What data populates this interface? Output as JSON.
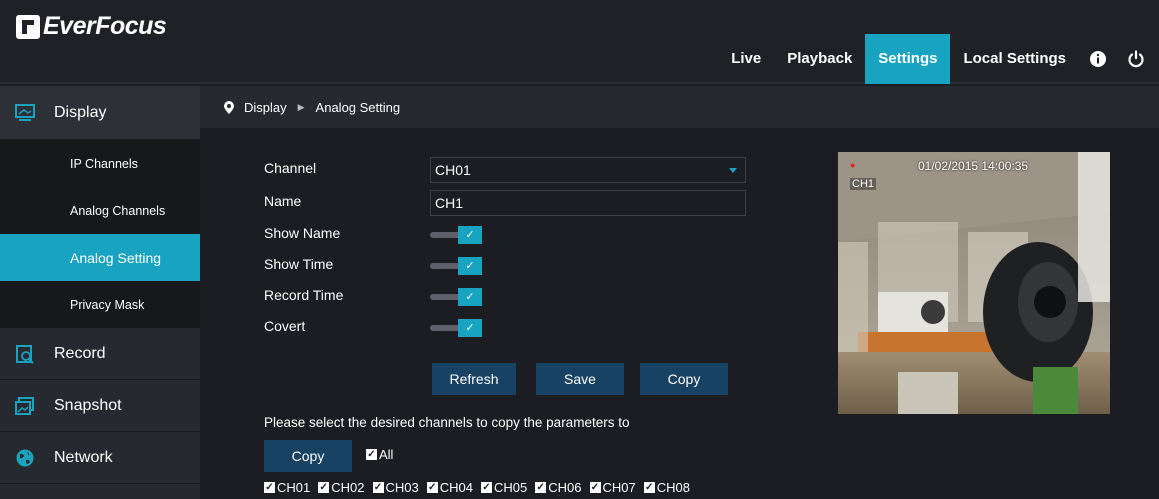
{
  "brand": {
    "name": "EverFocus"
  },
  "nav": {
    "items": [
      {
        "label": "Live",
        "active": false
      },
      {
        "label": "Playback",
        "active": false
      },
      {
        "label": "Settings",
        "active": true
      },
      {
        "label": "Local Settings",
        "active": false
      }
    ],
    "icons": [
      "info-icon",
      "power-icon"
    ]
  },
  "sidebar": {
    "display_label": "Display",
    "display_items": [
      {
        "label": "IP Channels"
      },
      {
        "label": "Analog Channels"
      },
      {
        "label": "Analog Setting"
      },
      {
        "label": "Privacy Mask"
      }
    ],
    "record_label": "Record",
    "snapshot_label": "Snapshot",
    "network_label": "Network"
  },
  "breadcrumb": {
    "root": "Display",
    "current": "Analog Setting"
  },
  "form": {
    "channel_label": "Channel",
    "channel_value": "CH01",
    "name_label": "Name",
    "name_value": "CH1",
    "show_name_label": "Show Name",
    "show_time_label": "Show Time",
    "record_time_label": "Record Time",
    "covert_label": "Covert",
    "toggles_checked": true
  },
  "buttons": {
    "refresh": "Refresh",
    "save": "Save",
    "copy": "Copy"
  },
  "preview": {
    "osd_time": "01/02/2015 14:00:35",
    "osd_name": "CH1"
  },
  "copy_section": {
    "message": "Please select the desired channels to copy the parameters to",
    "copy_button": "Copy",
    "all_label": "All",
    "channels": [
      "CH01",
      "CH02",
      "CH03",
      "CH04",
      "CH05",
      "CH06",
      "CH07",
      "CH08"
    ]
  },
  "colors": {
    "accent": "#18a4c1",
    "button": "#174263",
    "background": "#1b1d22",
    "sidebar": "#26292f"
  }
}
